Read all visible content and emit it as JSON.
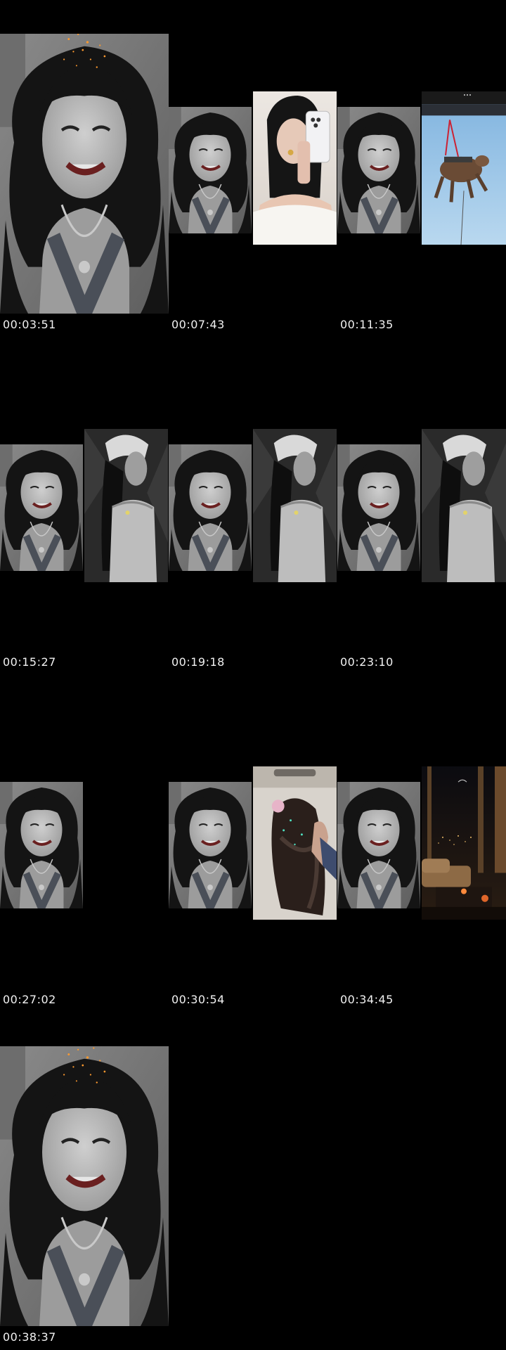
{
  "timestamps": [
    "00:03:51",
    "00:07:43",
    "00:11:35",
    "00:15:27",
    "00:19:18",
    "00:23:10",
    "00:27:02",
    "00:30:54",
    "00:34:45",
    "00:38:37"
  ]
}
